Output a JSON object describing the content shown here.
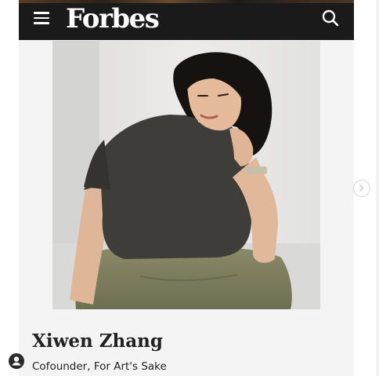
{
  "header": {
    "logo_text": "Forbes",
    "background_color": "#1a1a1a",
    "menu_icon": "hamburger-menu-icon",
    "search_icon": "search-icon"
  },
  "profile": {
    "name": "Xiwen Zhang",
    "title": "Cofounder, For Art's Sake"
  },
  "controls": {
    "next_icon": "chevron-right-icon",
    "account_icon": "account-circle-icon"
  }
}
